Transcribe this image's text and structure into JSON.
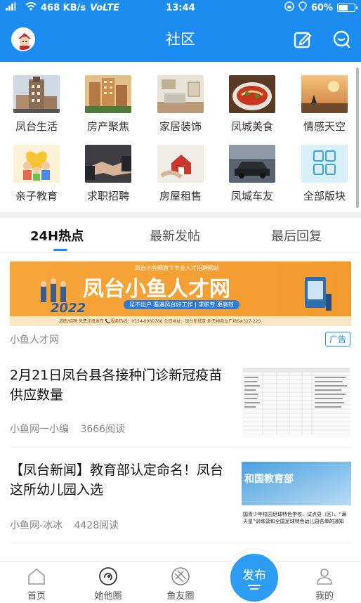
{
  "status_bar": {
    "network": "468 KB/s",
    "volte": "VoLTE",
    "time": "13:44",
    "battery": "60%",
    "battery_level": 0.6
  },
  "header": {
    "title": "社区",
    "avatar_icon": "user-avatar-icon",
    "left_icons": [
      "edit-icon",
      "chat-icon"
    ]
  },
  "categories": [
    {
      "label": "凤台生活",
      "icon": "building-photo"
    },
    {
      "label": "房产聚焦",
      "icon": "apartments-photo"
    },
    {
      "label": "家居装饰",
      "icon": "interior-photo"
    },
    {
      "label": "凤城美食",
      "icon": "food-photo"
    },
    {
      "label": "情感天空",
      "icon": "sunset-photo"
    },
    {
      "label": "亲子教育",
      "icon": "family-photo"
    },
    {
      "label": "求职招聘",
      "icon": "handshake-photo"
    },
    {
      "label": "房屋租售",
      "icon": "house-key-photo"
    },
    {
      "label": "凤城车友",
      "icon": "car-photo"
    },
    {
      "label": "全部版块",
      "icon": "grid-icon"
    }
  ],
  "tabs": [
    {
      "label": "24H热点",
      "active": true
    },
    {
      "label": "最新发帖",
      "active": false
    },
    {
      "label": "最后回复",
      "active": false
    }
  ],
  "ad": {
    "banner_title": "凤台小鱼人才网",
    "banner_top": "凤台小鱼网旗下专业人才招聘网站",
    "banner_sub": "足不出户 看遍凤台好工作 | 求职专 更高效",
    "banner_year": "2022",
    "banner_bottom": "求职/招聘 免费注册发布    📞服务热线：0554-8989788    公司地址：凤台新城区·新天地商业广场6#327-229",
    "source": "小鱼人才网",
    "badge": "广告"
  },
  "articles": [
    {
      "title": "2月21日凤台县各接种门诊新冠疫苗供应数量",
      "author": "小鱼网一小编",
      "views": "3666阅读"
    },
    {
      "title": "【凤台新闻】教育部认定命名！凤台这所幼儿园入选",
      "author": "小鱼网-冰冰",
      "views": "4428阅读",
      "thumb_header": "和国教育部",
      "thumb_caption": "国青少年校园足球特色学校、试点县（区）、“满天星”训练营和全国足球特色幼儿园名单的通知"
    }
  ],
  "bottom_nav": [
    {
      "label": "首页",
      "icon": "home-icon"
    },
    {
      "label": "她他圈",
      "icon": "circle-icon"
    },
    {
      "label": "鱼友圈",
      "icon": "aperture-icon"
    },
    {
      "label": "发布",
      "icon": "publish-icon"
    },
    {
      "label": "我的",
      "icon": "person-icon"
    }
  ],
  "colors": {
    "primary": "#1c8cf0",
    "ad_orange": "#f5a032"
  }
}
